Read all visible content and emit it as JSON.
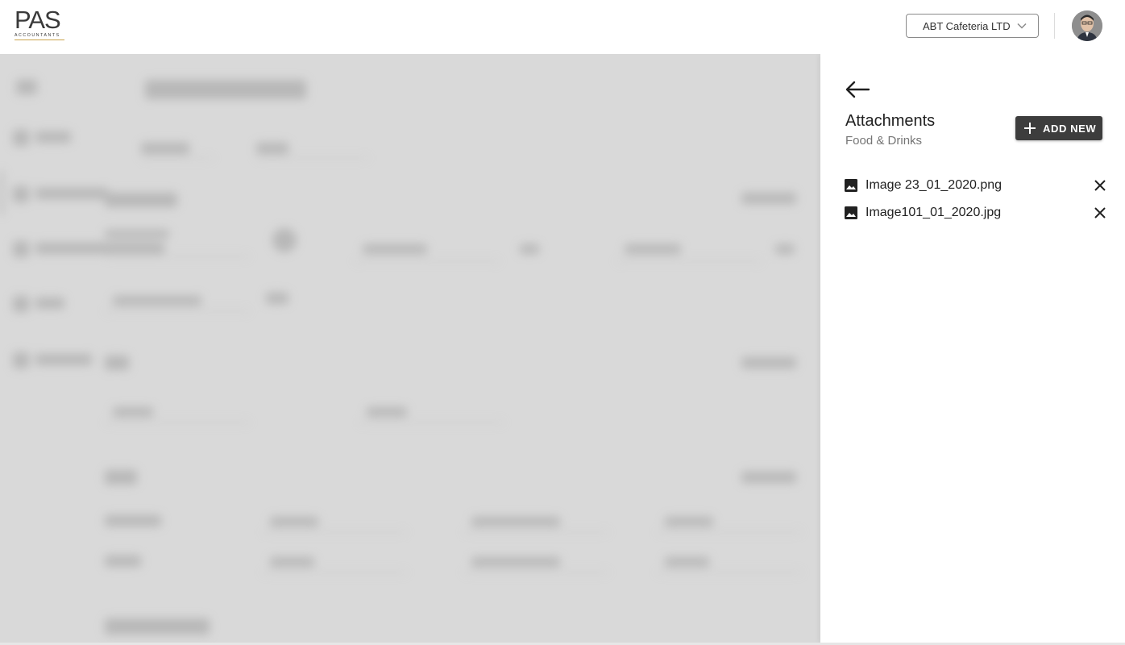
{
  "header": {
    "logo": {
      "brand": "PAS",
      "tagline": "ACCOUNTANTS"
    },
    "company_select": {
      "value": "ABT Cafeteria LTD",
      "icon": "chevron-down-icon"
    },
    "avatar_icon": "user-avatar"
  },
  "drawer": {
    "back_icon": "arrow-left-icon",
    "title": "Attachments",
    "subtitle": "Food & Drinks",
    "add_button": {
      "label": "ADD NEW",
      "icon": "plus-icon"
    },
    "attachments": [
      {
        "name": "Image 23_01_2020.png",
        "icon": "image-icon",
        "remove_icon": "close-icon"
      },
      {
        "name": "Image101_01_2020.jpg",
        "icon": "image-icon",
        "remove_icon": "close-icon"
      }
    ]
  },
  "colors": {
    "primary_button": "#3d3d3d",
    "overlay": "#d9d9d9",
    "brand_gold": "#c9a24a"
  }
}
